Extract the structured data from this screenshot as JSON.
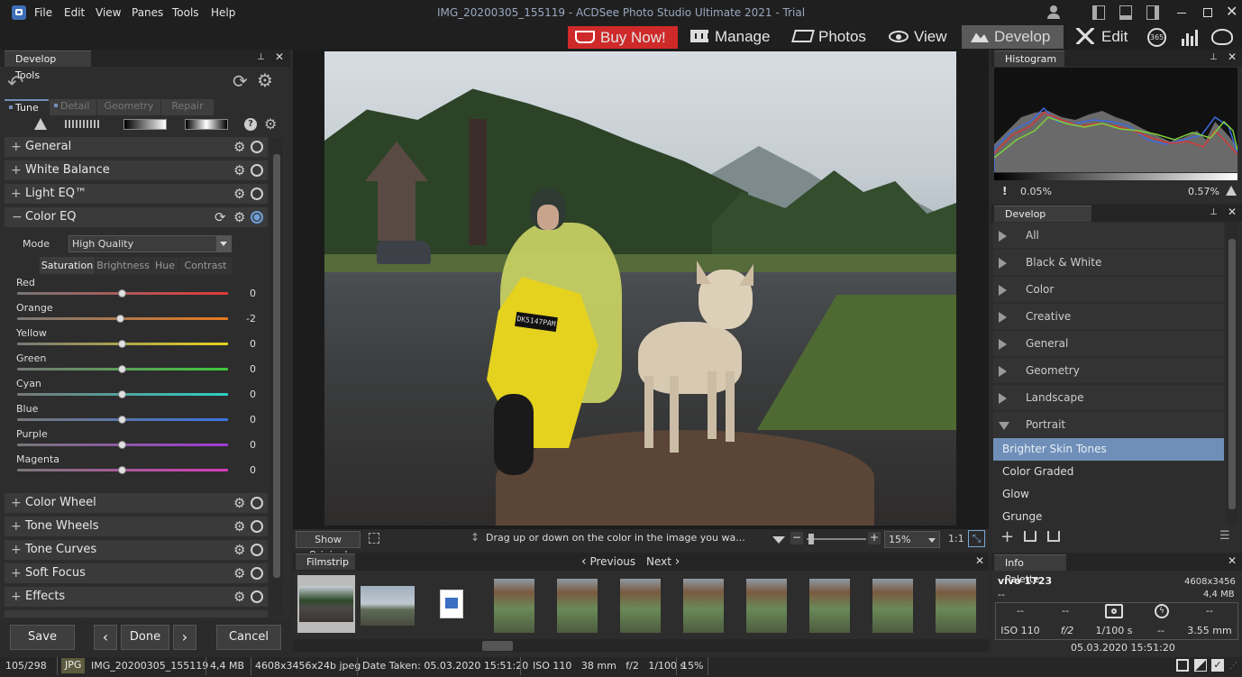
{
  "menu": [
    "File",
    "Edit",
    "View",
    "Panes",
    "Tools",
    "Help"
  ],
  "window_title": "IMG_20200305_155119 - ACDSee Photo Studio Ultimate 2021 - Trial",
  "modes": {
    "buy": "Buy Now!",
    "manage": "Manage",
    "photos": "Photos",
    "view": "View",
    "develop": "Develop",
    "edit": "Edit",
    "badge365": "365"
  },
  "develop_tools": {
    "title": "Develop Tools",
    "tabs": [
      "Tune",
      "Detail",
      "Geometry",
      "Repair"
    ],
    "sections_top": [
      "General",
      "White Balance",
      "Light EQ™",
      "Color EQ"
    ],
    "mode_label": "Mode",
    "mode_value": "High Quality",
    "subtabs": [
      "Saturation",
      "Brightness",
      "Hue",
      "Contrast"
    ],
    "sliders": [
      {
        "label": "Red",
        "value": "0",
        "num": 0
      },
      {
        "label": "Orange",
        "value": "-2",
        "num": -2
      },
      {
        "label": "Yellow",
        "value": "0",
        "num": 0
      },
      {
        "label": "Green",
        "value": "0",
        "num": 0
      },
      {
        "label": "Cyan",
        "value": "0",
        "num": 0
      },
      {
        "label": "Blue",
        "value": "0",
        "num": 0
      },
      {
        "label": "Purple",
        "value": "0",
        "num": 0
      },
      {
        "label": "Magenta",
        "value": "0",
        "num": 0
      }
    ],
    "sections_bottom": [
      "Color Wheel",
      "Tone Wheels",
      "Tone Curves",
      "Soft Focus",
      "Effects"
    ],
    "buttons": {
      "save": "Save",
      "done": "Done",
      "cancel": "Cancel"
    }
  },
  "viewer": {
    "show_original": "Show Original",
    "hint": "Drag up or down on the color in the image you wa...",
    "zoom": "15%",
    "one_to_one": "1:1"
  },
  "filmstrip": {
    "title": "Filmstrip",
    "previous": "Previous",
    "next": "Next"
  },
  "histogram": {
    "title": "Histogram",
    "left_pct": "0.05%",
    "right_pct": "0.57%"
  },
  "presets": {
    "title": "Develop Presets",
    "categories": [
      "All",
      "Black & White",
      "Color",
      "Creative",
      "General",
      "Geometry",
      "Landscape",
      "Portrait"
    ],
    "items": [
      "Brighter Skin Tones",
      "Color Graded",
      "Glow",
      "Grunge"
    ]
  },
  "info": {
    "title": "Info Palette",
    "camera": "vivo 1723",
    "dims": "4608x3456",
    "dash1": "--",
    "size": "4,4 MB",
    "row1": [
      "--",
      "--",
      "--",
      "--"
    ],
    "iso": "ISO 110",
    "fstop": "f/2",
    "shutter": "1/100 s",
    "dash2": "--",
    "focal": "3.55 mm",
    "date": "05.03.2020 15:51:20"
  },
  "status": {
    "count": "105/298",
    "type": "JPG",
    "file": "IMG_20200305_155119",
    "size": "4,4 MB",
    "dims": "4608x3456x24b jpeg",
    "taken": "Date Taken: 05.03.2020 15:51:20",
    "exif": "ISO 110   38 mm   f/2   1/100 s",
    "zoom": "15%"
  },
  "colors": {
    "accent": "#cf2a2a",
    "develop_bg": "#5a5a5a",
    "selected": "#6f8fb8"
  }
}
